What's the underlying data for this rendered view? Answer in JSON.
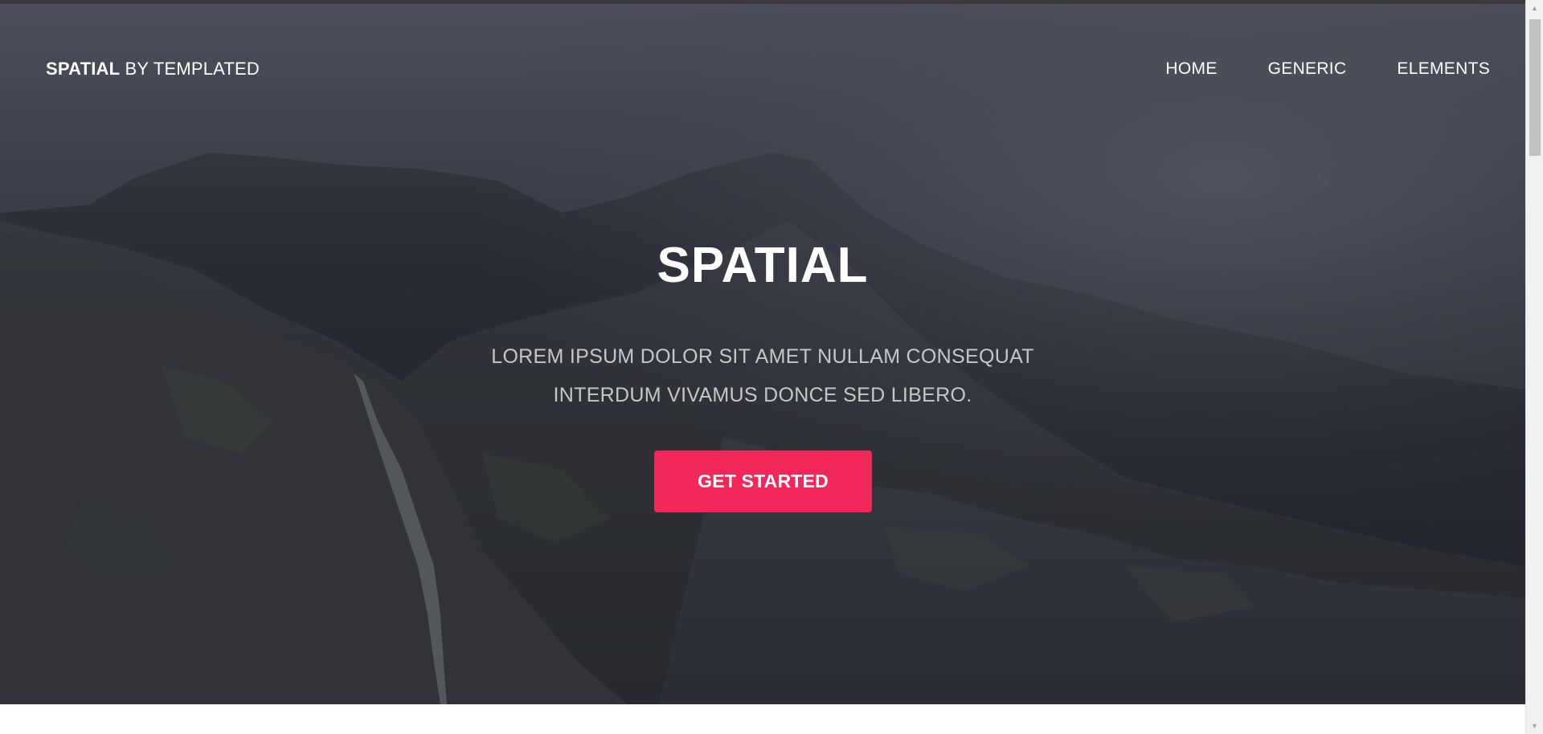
{
  "logo": {
    "strong": "SPATIAL",
    "rest": " BY TEMPLATED"
  },
  "nav": {
    "items": [
      {
        "label": "HOME"
      },
      {
        "label": "GENERIC"
      },
      {
        "label": "ELEMENTS"
      }
    ]
  },
  "hero": {
    "title": "SPATIAL",
    "subtitle_line1": "LOREM IPSUM DOLOR SIT AMET NULLAM CONSEQUAT",
    "subtitle_line2": "INTERDUM VIVAMUS DONCE SED LIBERO.",
    "cta_label": "GET STARTED"
  },
  "colors": {
    "accent": "#f2285a",
    "text_light": "#ffffff"
  },
  "icons": {
    "scroll_up": "arrow-up-icon",
    "scroll_down": "arrow-down-icon"
  }
}
